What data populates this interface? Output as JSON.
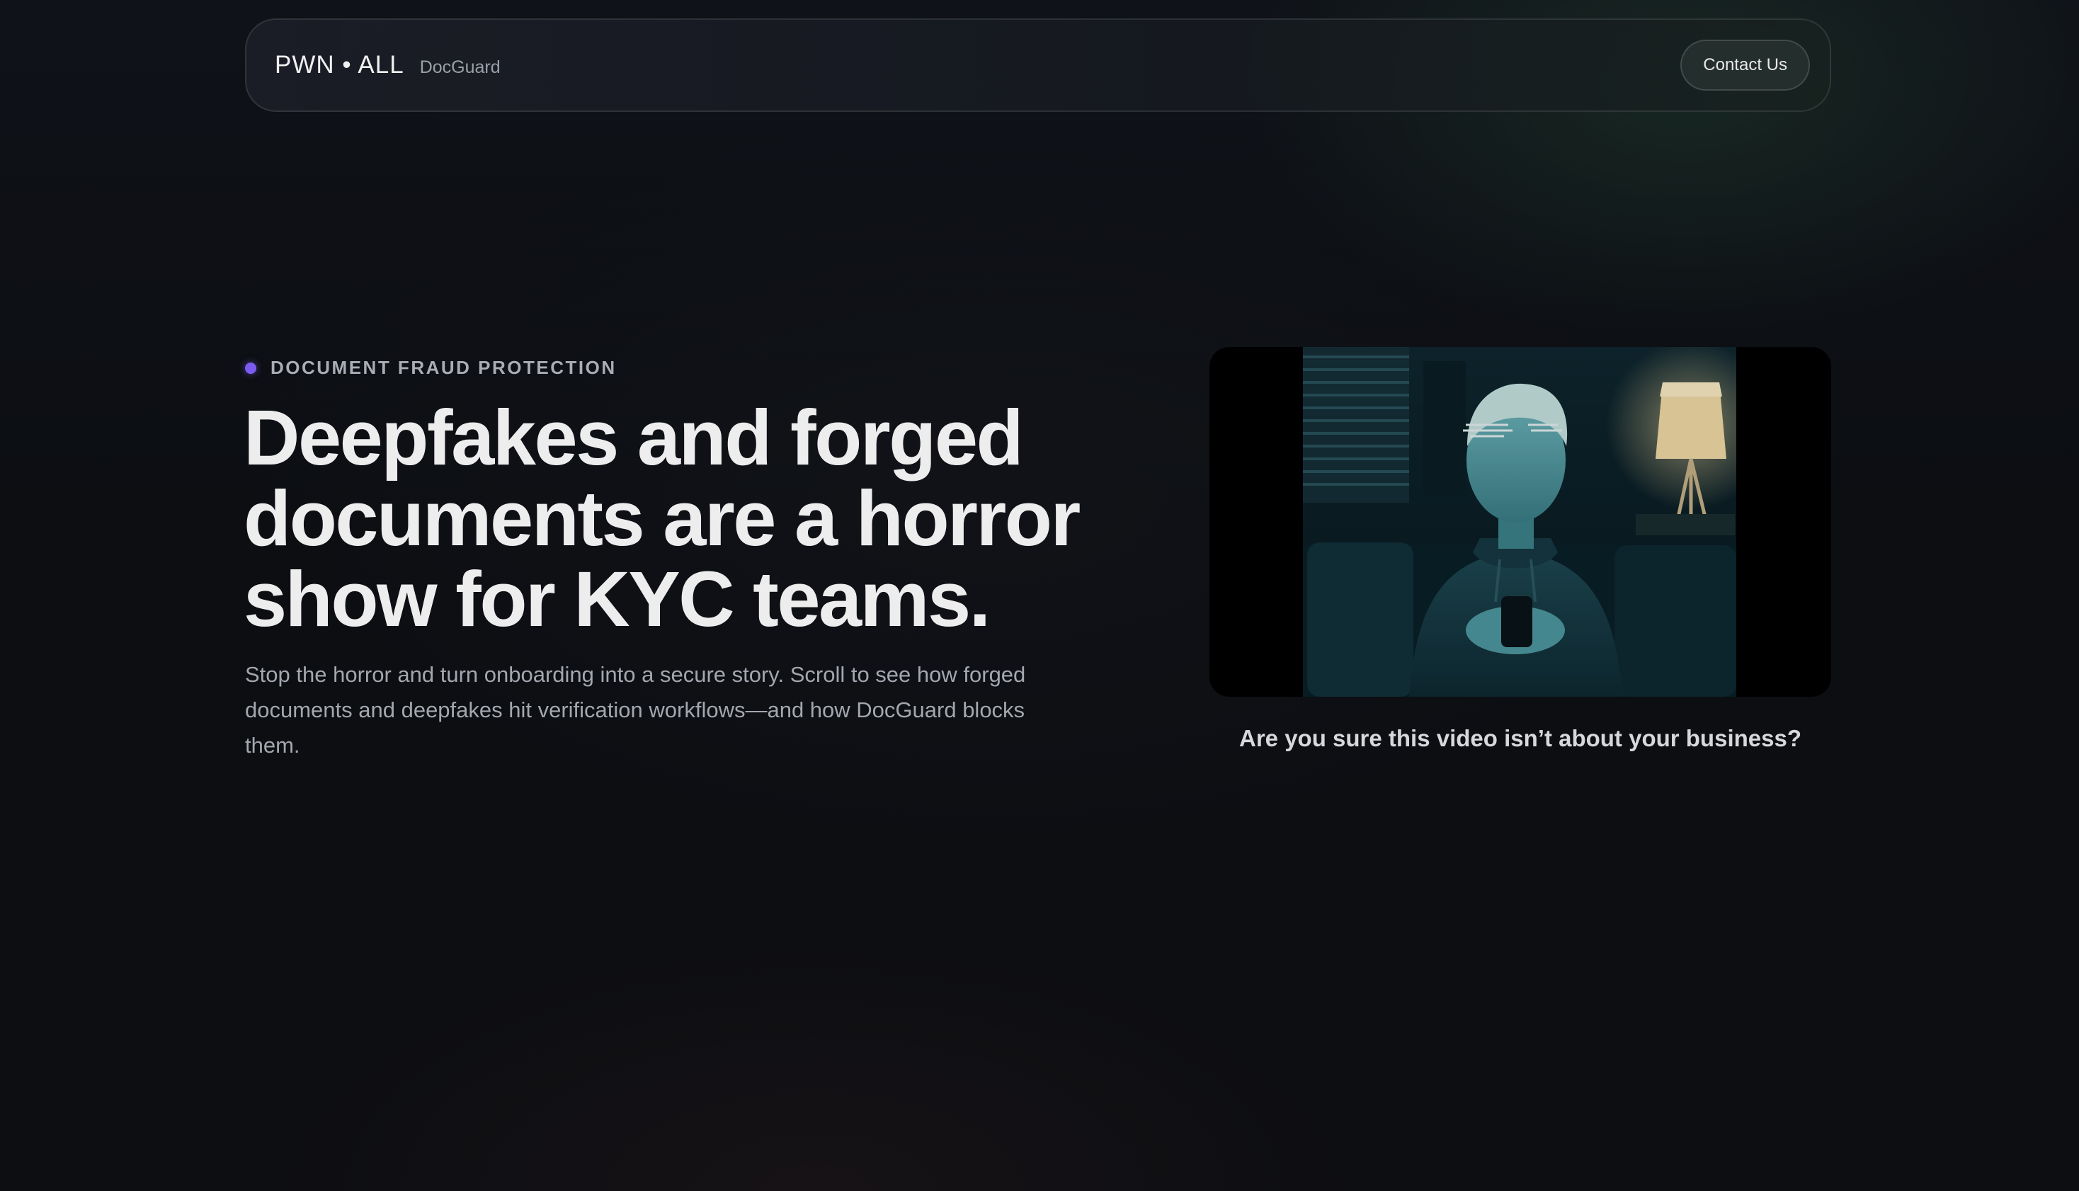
{
  "nav": {
    "brand_name": "PWN • ALL",
    "brand_product": "DocGuard",
    "contact_label": "Contact Us"
  },
  "hero": {
    "eyebrow": "DOCUMENT FRAUD PROTECTION",
    "headline": "Deepfakes and forged documents are a horror show for KYC teams.",
    "subcopy": "Stop the horror and turn onboarding into a secure story. Scroll to see how forged documents and deepfakes hit verification workflows—and how DocGuard blocks them.",
    "video_caption": "Are you sure this video isn’t about your business?"
  },
  "colors": {
    "accent_dot": "#7c5cf0",
    "background": "#0c0e12",
    "video_tint": "#3fb6c2"
  },
  "icons": {
    "eyebrow_marker": "dot-icon"
  }
}
